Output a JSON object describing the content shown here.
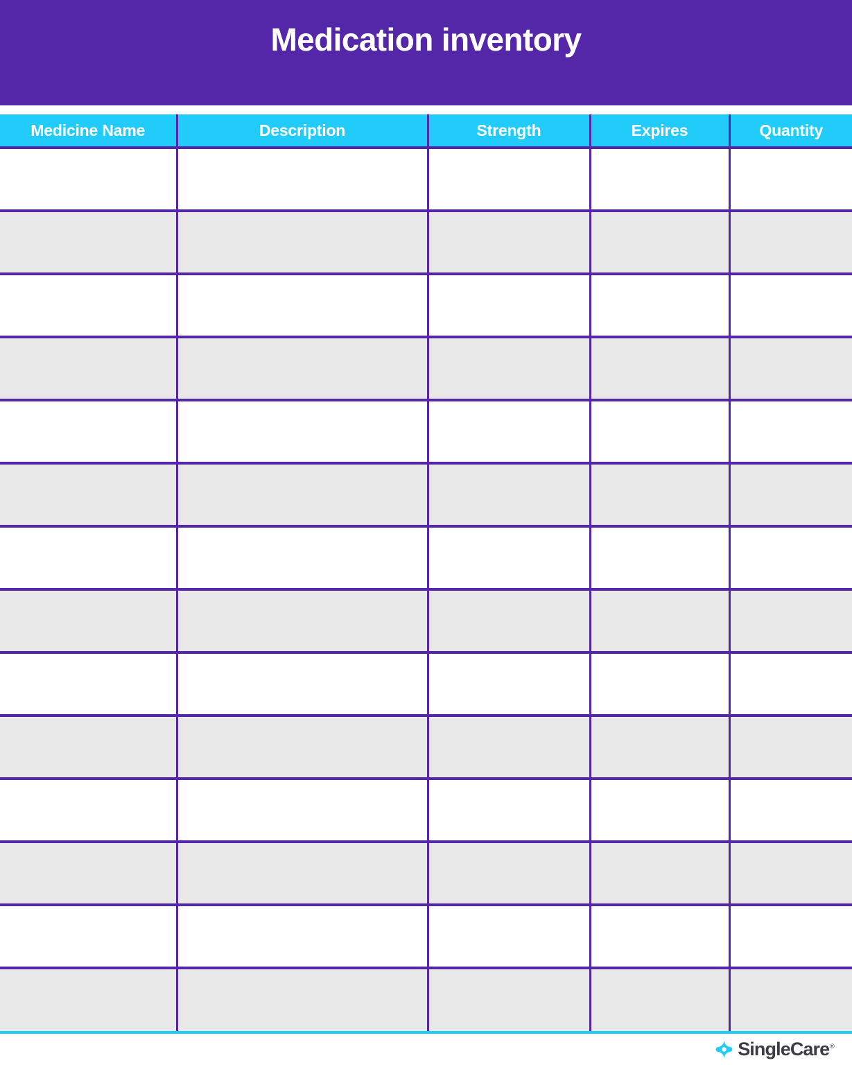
{
  "document": {
    "title": "Medication inventory"
  },
  "colors": {
    "banner_purple": "#5426A8",
    "header_cyan": "#22CCFA",
    "row_alt_gray": "#E8E8E8",
    "row_base_white": "#FFFFFF",
    "logo_cyan": "#22CCFA",
    "logo_text": "#3C3C46"
  },
  "table": {
    "columns": [
      {
        "key": "medicine_name",
        "label": "Medicine Name"
      },
      {
        "key": "description",
        "label": "Description"
      },
      {
        "key": "strength",
        "label": "Strength"
      },
      {
        "key": "expires",
        "label": "Expires"
      },
      {
        "key": "quantity",
        "label": "Quantity"
      }
    ],
    "row_count": 14,
    "rows": [
      {
        "medicine_name": "",
        "description": "",
        "strength": "",
        "expires": "",
        "quantity": ""
      },
      {
        "medicine_name": "",
        "description": "",
        "strength": "",
        "expires": "",
        "quantity": ""
      },
      {
        "medicine_name": "",
        "description": "",
        "strength": "",
        "expires": "",
        "quantity": ""
      },
      {
        "medicine_name": "",
        "description": "",
        "strength": "",
        "expires": "",
        "quantity": ""
      },
      {
        "medicine_name": "",
        "description": "",
        "strength": "",
        "expires": "",
        "quantity": ""
      },
      {
        "medicine_name": "",
        "description": "",
        "strength": "",
        "expires": "",
        "quantity": ""
      },
      {
        "medicine_name": "",
        "description": "",
        "strength": "",
        "expires": "",
        "quantity": ""
      },
      {
        "medicine_name": "",
        "description": "",
        "strength": "",
        "expires": "",
        "quantity": ""
      },
      {
        "medicine_name": "",
        "description": "",
        "strength": "",
        "expires": "",
        "quantity": ""
      },
      {
        "medicine_name": "",
        "description": "",
        "strength": "",
        "expires": "",
        "quantity": ""
      },
      {
        "medicine_name": "",
        "description": "",
        "strength": "",
        "expires": "",
        "quantity": ""
      },
      {
        "medicine_name": "",
        "description": "",
        "strength": "",
        "expires": "",
        "quantity": ""
      },
      {
        "medicine_name": "",
        "description": "",
        "strength": "",
        "expires": "",
        "quantity": ""
      },
      {
        "medicine_name": "",
        "description": "",
        "strength": "",
        "expires": "",
        "quantity": ""
      }
    ]
  },
  "footer": {
    "brand_name": "SingleCare",
    "trademark": "®",
    "logo_icon": "singlecare-diamond-cross-icon"
  }
}
